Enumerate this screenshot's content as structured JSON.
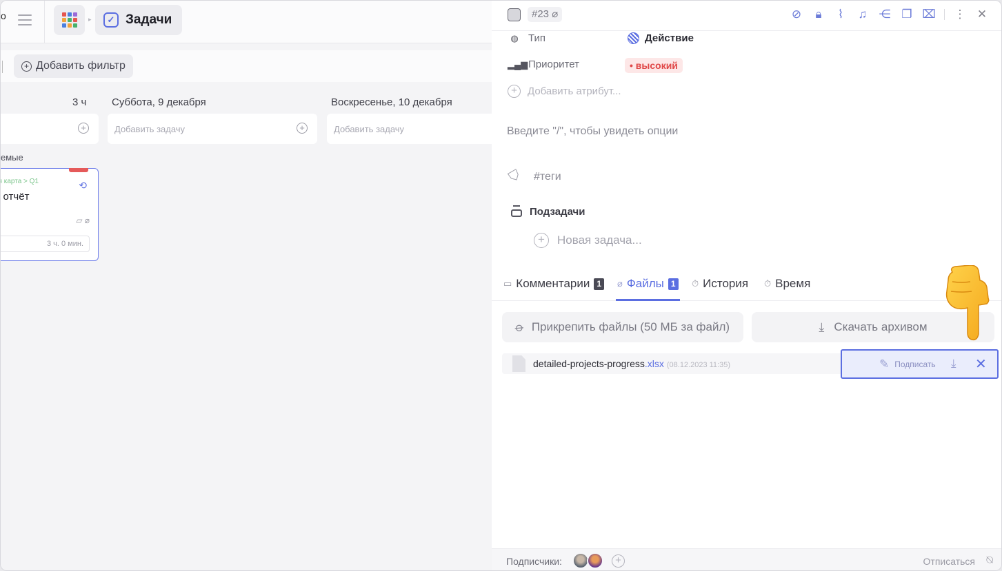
{
  "left": {
    "cut_text": "о",
    "breadcrumb_title": "Задачи",
    "add_filter_label": "Добавить фильтр",
    "columns": [
      {
        "header": "3 ч",
        "placeholder": ""
      },
      {
        "header": "Суббота, 9 декабря",
        "placeholder": "Добавить задачу"
      },
      {
        "header": "Воскресенье, 10 декабря",
        "placeholder": "Добавить задачу"
      }
    ],
    "section_label": "емые",
    "card": {
      "path": "ая карта > Q1",
      "title": "й отчёт",
      "time": "3 ч. 0 мин."
    },
    "apps_colors": [
      "#e5554f",
      "#4a7fe0",
      "#9b6ad8",
      "#f2a33a",
      "#47b26b",
      "#e5554f",
      "#4a7fe0",
      "#f2a33a",
      "#47b26b"
    ]
  },
  "panel": {
    "task_number": "#23",
    "header_icons": [
      "eye-off-icon",
      "lock-icon",
      "paperclip-icon",
      "bell-off-icon",
      "hierarchy-icon",
      "copy-icon",
      "trash-icon",
      "more-icon",
      "close-icon"
    ],
    "attrs": {
      "type_label": "Тип",
      "type_value": "Действие",
      "priority_label": "Приоритет",
      "priority_value": "• высокий",
      "add_attribute": "Добавить атрибут..."
    },
    "description_hint": "Введите \"/\", чтобы увидеть опции",
    "tags_placeholder": "#теги",
    "subtasks_label": "Подзадачи",
    "new_task_label": "Новая задача...",
    "tabs": [
      {
        "label": "Комментарии",
        "badge": "1"
      },
      {
        "label": "Файлы",
        "badge": "1"
      },
      {
        "label": "История"
      },
      {
        "label": "Время"
      }
    ],
    "attach_label": "Прикрепить файлы (50 МБ за файл)",
    "download_archive_label": "Скачать архивом",
    "file": {
      "name": "detailed-projects-progress",
      "ext": ".xlsx",
      "date": "(08.12.2023 11:35)"
    },
    "sign_label": "Подписать",
    "footer": {
      "subscribers_label": "Подписчики:",
      "unsubscribe_label": "Отписаться"
    }
  },
  "accent_color": "#5b6ee1",
  "priority_color": "#e04848"
}
